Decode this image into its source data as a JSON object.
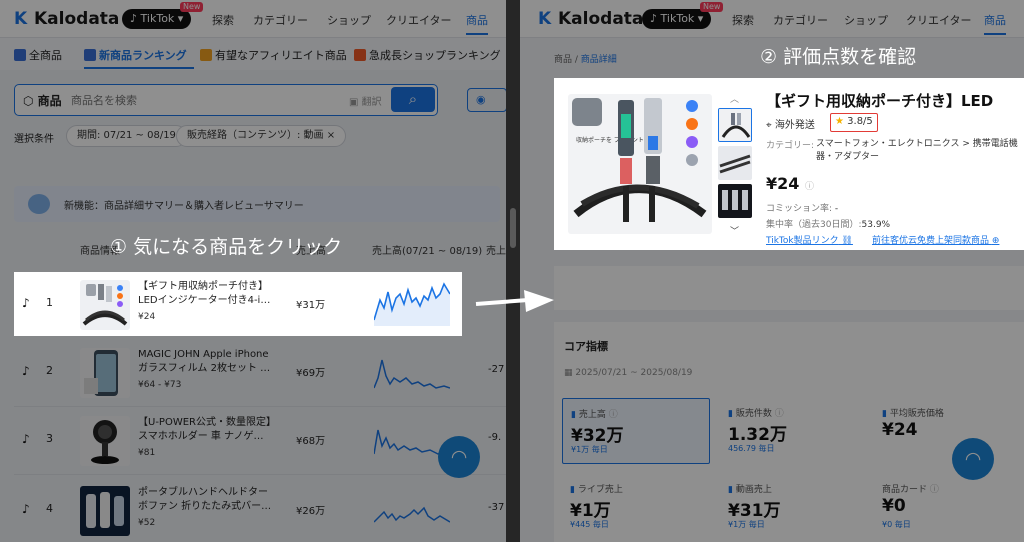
{
  "left": {
    "brand": "Kalodata",
    "platform": "TikTok",
    "new_badge": "New",
    "nav": [
      "探索",
      "カテゴリー",
      "ショップ",
      "クリエイター",
      "商品"
    ],
    "tabs": [
      "全商品",
      "新商品ランキング",
      "有望なアフィリエイト商品",
      "急成長ショップランキング"
    ],
    "search": {
      "category": "商品",
      "placeholder": "商品名を検索",
      "translate": "翻訳"
    },
    "filters_label": "選択条件",
    "chips": [
      "期間: 07/21 ~ 08/19",
      "販売経路（コンテンツ）: 動画"
    ],
    "chip_close": "×",
    "banner": "新機能：商品詳細サマリー＆購入者レビューサマリー",
    "columns": [
      "商品情報",
      "売上高",
      "売上高(07/21 ~ 08/19)",
      "売上"
    ],
    "rows": [
      {
        "rank": "1",
        "name1": "【ギフト用収納ポーチ付き】",
        "name2": "LEDインジケーター付き4-i…",
        "price": "¥24",
        "sales": "¥31万",
        "pct": ""
      },
      {
        "rank": "2",
        "name1": "MAGIC JOHN Apple iPhone",
        "name2": "ガラスフィルム 2枚セット …",
        "price": "¥64 - ¥73",
        "sales": "¥69万",
        "pct": "-27"
      },
      {
        "rank": "3",
        "name1": "【U-POWER公式・数量限定】",
        "name2": "スマホホルダー 車 ナノゲ…",
        "price": "¥81",
        "sales": "¥68万",
        "pct": "-9."
      },
      {
        "rank": "4",
        "name1": "ポータブルハンドヘルドター",
        "name2": "ボファン 折りたたみ式バー…",
        "price": "¥52",
        "sales": "¥26万",
        "pct": "-37"
      }
    ],
    "annotation": "① 気になる商品をクリック"
  },
  "right": {
    "breadcrumb_root": "商品",
    "breadcrumb_current": "商品詳細",
    "title": "【ギフト用収納ポーチ付き】LED",
    "shipping": "海外発送",
    "rating": "3.8/5",
    "category_label": "カテゴリー:",
    "category_value": "スマートフォン・エレクトロニクス > 携帯電話機器・アダプター",
    "price": "¥24",
    "commission_label": "コミッション率:",
    "commission_value": "-",
    "concentration_label": "集中率（過去30日間）:",
    "concentration_value": "53.9%",
    "link1": "TikTok製品リンク",
    "link2": "前往客优云免费上架同款商品",
    "pouch_caption": "収納ポーチを プレゼント",
    "core_title": "コア指標",
    "core_dates": "2025/07/21 ~ 2025/08/19",
    "metrics": [
      {
        "label": "売上高",
        "value": "¥32万",
        "sub": "¥1万 毎日"
      },
      {
        "label": "販売件数",
        "value": "1.32万",
        "sub": "456.79 毎日"
      },
      {
        "label": "平均販売価格",
        "value": "¥24",
        "sub": ""
      },
      {
        "label": "ライブ売上",
        "value": "¥1万",
        "sub": "¥445 毎日"
      },
      {
        "label": "動画売上",
        "value": "¥31万",
        "sub": "¥1万 毎日"
      },
      {
        "label": "商品カード",
        "value": "¥0",
        "sub": "¥0 毎日"
      }
    ],
    "annotation": "② 評価点数を確認"
  },
  "colors": {
    "accent": "#1b74e4",
    "rating_border": "#e23b36",
    "overlay": "rgba(0,0,0,0.44)"
  }
}
